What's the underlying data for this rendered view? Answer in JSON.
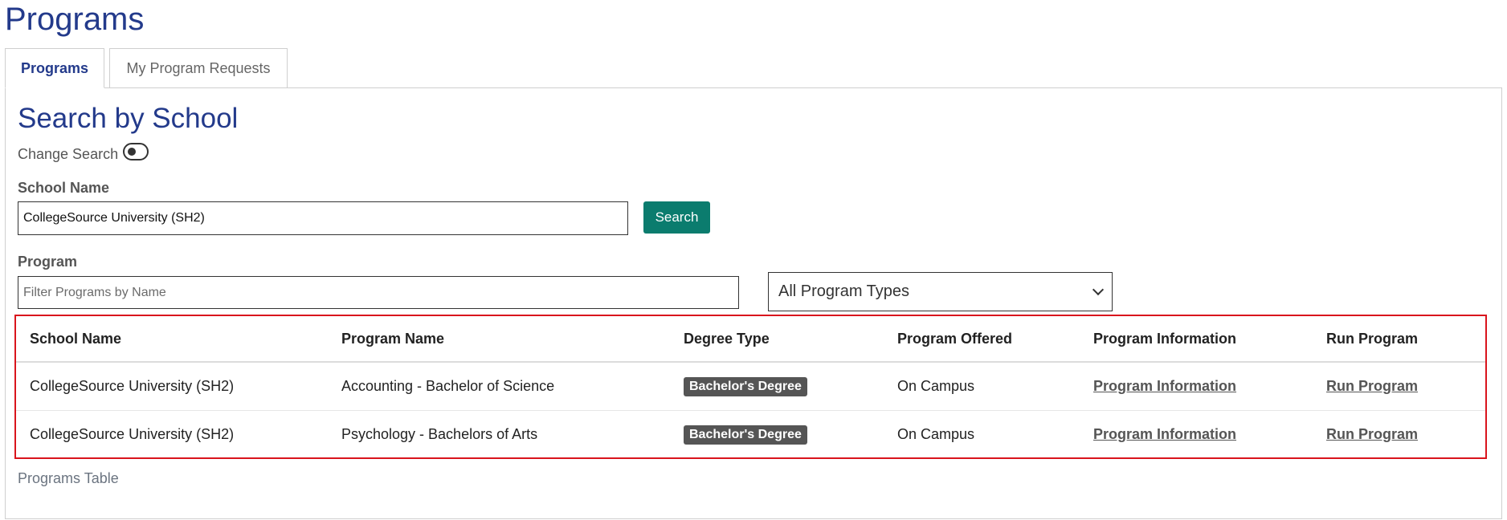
{
  "page": {
    "title": "Programs"
  },
  "tabs": [
    {
      "label": "Programs",
      "active": true
    },
    {
      "label": "My Program Requests",
      "active": false
    }
  ],
  "search": {
    "title": "Search by School",
    "change_search_label": "Change Search",
    "school_label": "School Name",
    "school_value": "CollegeSource University (SH2)",
    "search_button": "Search",
    "program_label": "Program",
    "filter_placeholder": "Filter Programs by Name",
    "program_type_selected": "All Program Types"
  },
  "table": {
    "headers": [
      "School Name",
      "Program Name",
      "Degree Type",
      "Program Offered",
      "Program Information",
      "Run Program"
    ],
    "rows": [
      {
        "school": "CollegeSource University (SH2)",
        "program": "Accounting - Bachelor of Science",
        "degree": "Bachelor's Degree",
        "offered": "On Campus",
        "info_link": "Program Information",
        "run_link": "Run Program"
      },
      {
        "school": "CollegeSource University (SH2)",
        "program": "Psychology - Bachelors of Arts",
        "degree": "Bachelor's Degree",
        "offered": "On Campus",
        "info_link": "Program Information",
        "run_link": "Run Program"
      }
    ],
    "caption": "Programs Table"
  },
  "colors": {
    "brand_blue": "#233a8b",
    "search_button": "#0b7c6e",
    "badge": "#555555",
    "highlight_border": "#d9141c"
  },
  "icons": {
    "toggle": "toggle-switch-icon",
    "dropdown": "chevron-down-icon"
  }
}
